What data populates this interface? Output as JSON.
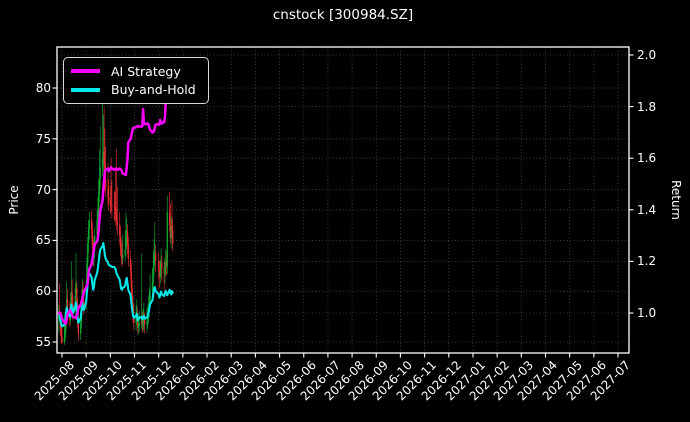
{
  "title": "cnstock [300984.SZ]",
  "axes": {
    "y_left": {
      "label": "Price",
      "ticks": [
        55,
        60,
        65,
        70,
        75,
        80
      ]
    },
    "y_right": {
      "label": "Return",
      "ticks": [
        "1.0",
        "1.2",
        "1.4",
        "1.6",
        "1.8",
        "2.0"
      ]
    },
    "x": {
      "tick_labels": [
        "2025-08",
        "2025-09",
        "2025-10",
        "2025-11",
        "2025-12",
        "2026-01",
        "2026-02",
        "2026-03",
        "2026-04",
        "2026-05",
        "2026-06",
        "2026-07",
        "2026-08",
        "2026-09",
        "2026-10",
        "2026-11",
        "2026-12",
        "2027-01",
        "2027-02",
        "2027-03",
        "2027-04",
        "2027-05",
        "2027-06",
        "2027-07"
      ]
    }
  },
  "legend": {
    "items": [
      {
        "label": "AI Strategy",
        "color": "#ff00ff"
      },
      {
        "label": "Buy-and-Hold",
        "color": "#00e8e8"
      }
    ]
  },
  "colors": {
    "background": "#000000",
    "grid": "#4c4c4c",
    "spine": "#ffffff",
    "text": "#ffffff",
    "candle_up": "#0ca832",
    "candle_down": "#e62e2e",
    "ai_strategy": "#ff00ff",
    "buy_and_hold": "#00e8e8"
  },
  "chart_data": [
    {
      "type": "candlestick",
      "title": "cnstock [300984.SZ]",
      "ylabel": "Price",
      "ylim": [
        53.9,
        84.0
      ],
      "x_range": [
        "2025-08",
        "2027-07"
      ],
      "grid": true,
      "dates": [
        "2025-07-28",
        "2025-07-29",
        "2025-07-30",
        "2025-07-31",
        "2025-08-01",
        "2025-08-04",
        "2025-08-05",
        "2025-08-06",
        "2025-08-07",
        "2025-08-08",
        "2025-08-11",
        "2025-08-12",
        "2025-08-13",
        "2025-08-14",
        "2025-08-15",
        "2025-08-18",
        "2025-08-19",
        "2025-08-20",
        "2025-08-21",
        "2025-08-22",
        "2025-08-25",
        "2025-08-26",
        "2025-08-27",
        "2025-08-28",
        "2025-08-29",
        "2025-09-01",
        "2025-09-02",
        "2025-09-03",
        "2025-09-04",
        "2025-09-05",
        "2025-09-08",
        "2025-09-09",
        "2025-09-10",
        "2025-09-11",
        "2025-09-12",
        "2025-09-15",
        "2025-09-16",
        "2025-09-17",
        "2025-09-18",
        "2025-09-19",
        "2025-09-22",
        "2025-09-23",
        "2025-09-24",
        "2025-09-25",
        "2025-09-26",
        "2025-09-29",
        "2025-09-30",
        "2025-10-01",
        "2025-10-02",
        "2025-10-03",
        "2025-10-06",
        "2025-10-07",
        "2025-10-08",
        "2025-10-09",
        "2025-10-10",
        "2025-10-13",
        "2025-10-14",
        "2025-10-15",
        "2025-10-16",
        "2025-10-17",
        "2025-10-20",
        "2025-10-21",
        "2025-10-22",
        "2025-10-23",
        "2025-10-24",
        "2025-10-27",
        "2025-10-28",
        "2025-10-29",
        "2025-10-30",
        "2025-10-31",
        "2025-11-03",
        "2025-11-04",
        "2025-11-05",
        "2025-11-06",
        "2025-11-07",
        "2025-11-10",
        "2025-11-11",
        "2025-11-12",
        "2025-11-13",
        "2025-11-14",
        "2025-11-17",
        "2025-11-18",
        "2025-11-19",
        "2025-11-20",
        "2025-11-21",
        "2025-11-24",
        "2025-11-25",
        "2025-11-26",
        "2025-11-27",
        "2025-11-28",
        "2025-12-01",
        "2025-12-02",
        "2025-12-03",
        "2025-12-04",
        "2025-12-05",
        "2025-12-08",
        "2025-12-09",
        "2025-12-10",
        "2025-12-11",
        "2025-12-12",
        "2025-12-15",
        "2025-12-16",
        "2025-12-17",
        "2025-12-18",
        "2025-12-19"
      ],
      "ohlc": [
        [
          57.2,
          58.6,
          55.9,
          58.0
        ],
        [
          58.0,
          60.8,
          56.9,
          57.3
        ],
        [
          57.3,
          58.0,
          55.6,
          56.2
        ],
        [
          56.2,
          57.2,
          54.9,
          55.5
        ],
        [
          55.5,
          56.4,
          54.8,
          55.0
        ],
        [
          55.0,
          56.6,
          54.7,
          55.4
        ],
        [
          55.4,
          57.9,
          55.0,
          56.2
        ],
        [
          56.2,
          58.4,
          55.7,
          57.8
        ],
        [
          57.8,
          60.9,
          57.2,
          59.2
        ],
        [
          59.2,
          60.2,
          57.6,
          58.3
        ],
        [
          58.3,
          59.0,
          56.5,
          57.2
        ],
        [
          57.2,
          59.9,
          56.8,
          58.6
        ],
        [
          58.6,
          62.9,
          58.0,
          59.9
        ],
        [
          59.9,
          61.2,
          58.2,
          58.8
        ],
        [
          58.8,
          59.6,
          57.1,
          58.0
        ],
        [
          58.0,
          60.8,
          57.5,
          59.6
        ],
        [
          59.6,
          63.8,
          59.0,
          60.3
        ],
        [
          60.3,
          61.0,
          58.2,
          58.7
        ],
        [
          58.7,
          59.3,
          56.4,
          56.9
        ],
        [
          56.9,
          57.8,
          55.1,
          55.8
        ],
        [
          55.8,
          57.6,
          55.2,
          56.9
        ],
        [
          56.9,
          59.5,
          56.3,
          58.7
        ],
        [
          58.7,
          61.2,
          58.1,
          60.2
        ],
        [
          60.2,
          61.0,
          58.4,
          59.0
        ],
        [
          59.0,
          59.8,
          57.7,
          58.7
        ],
        [
          58.7,
          61.1,
          58.2,
          60.5
        ],
        [
          60.5,
          63.4,
          59.8,
          62.8
        ],
        [
          62.8,
          65.3,
          62.0,
          64.7
        ],
        [
          64.7,
          67.0,
          63.8,
          66.2
        ],
        [
          66.2,
          67.8,
          65.1,
          67.0
        ],
        [
          67.0,
          67.9,
          65.2,
          66.0
        ],
        [
          66.0,
          66.8,
          63.8,
          64.5
        ],
        [
          64.5,
          65.4,
          62.5,
          63.2
        ],
        [
          63.2,
          65.0,
          62.4,
          64.0
        ],
        [
          64.0,
          66.3,
          63.3,
          65.5
        ],
        [
          65.5,
          68.0,
          64.8,
          67.0
        ],
        [
          67.0,
          69.2,
          66.1,
          68.1
        ],
        [
          68.1,
          71.0,
          67.3,
          69.5
        ],
        [
          69.5,
          73.9,
          68.8,
          71.0
        ],
        [
          71.0,
          76.2,
          70.1,
          72.2
        ],
        [
          72.2,
          78.8,
          71.3,
          73.0
        ],
        [
          73.0,
          77.4,
          71.8,
          73.7
        ],
        [
          73.7,
          78.1,
          71.5,
          72.5
        ],
        [
          72.5,
          76.0,
          69.9,
          71.0
        ],
        [
          71.0,
          74.2,
          69.3,
          70.2
        ],
        [
          70.2,
          72.6,
          68.4,
          69.3
        ],
        [
          69.3,
          71.0,
          67.9,
          68.8
        ],
        [
          68.8,
          70.4,
          67.6,
          68.6
        ],
        [
          68.6,
          73.1,
          67.8,
          68.5
        ],
        [
          68.5,
          70.9,
          67.2,
          68.4
        ],
        [
          68.4,
          69.8,
          66.9,
          68.3
        ],
        [
          68.3,
          69.9,
          67.0,
          68.1
        ],
        [
          68.1,
          72.2,
          66.5,
          67.6
        ],
        [
          67.6,
          74.0,
          66.0,
          66.8
        ],
        [
          66.8,
          70.3,
          65.5,
          66.5
        ],
        [
          66.5,
          67.8,
          64.6,
          65.5
        ],
        [
          65.5,
          66.4,
          63.5,
          64.3
        ],
        [
          64.3,
          65.2,
          62.6,
          63.4
        ],
        [
          63.4,
          64.8,
          62.4,
          63.2
        ],
        [
          63.2,
          65.6,
          62.7,
          63.6
        ],
        [
          63.6,
          66.0,
          63.0,
          64.1
        ],
        [
          64.1,
          67.7,
          63.4,
          65.3
        ],
        [
          65.3,
          67.2,
          64.4,
          65.9
        ],
        [
          65.9,
          66.6,
          63.7,
          64.6
        ],
        [
          64.6,
          65.3,
          62.4,
          63.2
        ],
        [
          63.2,
          64.0,
          61.2,
          62.0
        ],
        [
          62.0,
          62.8,
          59.6,
          60.3
        ],
        [
          60.3,
          61.1,
          58.0,
          58.7
        ],
        [
          58.7,
          59.5,
          56.9,
          57.6
        ],
        [
          57.6,
          58.8,
          56.2,
          56.9
        ],
        [
          56.9,
          58.6,
          56.1,
          57.4
        ],
        [
          57.4,
          59.2,
          56.7,
          57.8
        ],
        [
          57.8,
          58.4,
          55.8,
          56.4
        ],
        [
          56.4,
          57.7,
          55.7,
          56.6
        ],
        [
          56.6,
          58.1,
          56.0,
          56.9
        ],
        [
          56.9,
          63.7,
          56.3,
          57.2
        ],
        [
          57.2,
          58.0,
          55.9,
          56.6
        ],
        [
          56.6,
          58.3,
          56.0,
          56.9
        ],
        [
          56.9,
          58.9,
          56.2,
          57.3
        ],
        [
          57.3,
          57.9,
          55.8,
          56.7
        ],
        [
          56.7,
          58.4,
          55.9,
          57.0
        ],
        [
          57.0,
          58.7,
          56.3,
          57.5
        ],
        [
          57.5,
          59.6,
          56.8,
          58.2
        ],
        [
          58.2,
          60.4,
          57.4,
          59.0
        ],
        [
          59.0,
          61.7,
          58.3,
          60.0
        ],
        [
          60.0,
          62.3,
          59.2,
          60.9
        ],
        [
          60.9,
          64.0,
          60.1,
          62.2
        ],
        [
          62.2,
          65.1,
          61.4,
          63.4
        ],
        [
          63.4,
          66.8,
          62.6,
          63.8
        ],
        [
          63.8,
          64.6,
          61.9,
          63.0
        ],
        [
          63.0,
          63.8,
          61.2,
          62.2
        ],
        [
          62.2,
          63.0,
          60.3,
          61.5
        ],
        [
          61.5,
          63.1,
          60.7,
          62.0
        ],
        [
          62.0,
          64.2,
          61.3,
          62.8
        ],
        [
          62.8,
          63.5,
          60.9,
          62.2
        ],
        [
          62.2,
          62.9,
          60.1,
          61.8
        ],
        [
          61.8,
          63.3,
          60.8,
          62.4
        ],
        [
          62.4,
          64.1,
          61.5,
          63.0
        ],
        [
          63.0,
          63.9,
          61.6,
          62.4
        ],
        [
          62.4,
          69.4,
          61.7,
          67.8
        ],
        [
          67.8,
          69.7,
          65.9,
          66.5
        ],
        [
          66.5,
          68.6,
          64.7,
          65.2
        ],
        [
          65.2,
          67.3,
          64.2,
          66.4
        ],
        [
          66.4,
          68.9,
          65.3,
          66.0
        ],
        [
          66.0,
          67.1,
          63.9,
          64.6
        ]
      ]
    },
    {
      "type": "line",
      "ylabel": "Return",
      "ylim": [
        0.85,
        2.03
      ],
      "x_range": [
        "2025-08",
        "2027-07"
      ],
      "grid": true,
      "legend_position": "upper left",
      "dates_shared_with": "candlestick",
      "series": [
        {
          "name": "AI Strategy",
          "axis": "right",
          "values": [
            1.0,
            1.002,
            0.998,
            0.99,
            0.978,
            0.965,
            0.96,
            0.958,
            0.975,
            0.995,
            1.01,
            1.006,
            1.0,
            0.992,
            0.985,
            0.982,
            0.98,
            0.99,
            1.0,
            1.02,
            1.032,
            1.045,
            1.055,
            1.065,
            1.082,
            1.1,
            1.108,
            1.115,
            1.15,
            1.17,
            1.19,
            1.21,
            1.23,
            1.248,
            1.265,
            1.278,
            1.29,
            1.32,
            1.357,
            1.395,
            1.437,
            1.48,
            1.515,
            1.55,
            1.555,
            1.56,
            1.55,
            1.558,
            1.565,
            1.56,
            1.555,
            1.558,
            1.56,
            1.557,
            1.555,
            1.56,
            1.558,
            1.555,
            1.548,
            1.54,
            1.537,
            1.535,
            1.568,
            1.6,
            1.66,
            1.675,
            1.69,
            1.702,
            1.715,
            1.718,
            1.72,
            1.722,
            1.724,
            1.725,
            1.723,
            1.722,
            1.724,
            1.79,
            1.735,
            1.732,
            1.734,
            1.735,
            1.73,
            1.72,
            1.71,
            1.7,
            1.702,
            1.705,
            1.718,
            1.73,
            1.732,
            1.73,
            1.748,
            1.74,
            1.735,
            1.74,
            1.76,
            1.82,
            1.88,
            1.935,
            1.96,
            1.97,
            null,
            null,
            null
          ]
        },
        {
          "name": "Buy-and-Hold",
          "axis": "right",
          "values": [
            1.0,
            0.988,
            0.969,
            0.957,
            0.948,
            0.955,
            0.969,
            0.997,
            1.021,
            1.005,
            0.986,
            1.01,
            1.033,
            1.014,
            1.0,
            1.028,
            1.04,
            1.012,
            0.981,
            0.962,
            0.981,
            1.012,
            1.038,
            1.017,
            1.012,
            1.043,
            1.083,
            1.116,
            1.141,
            1.155,
            1.138,
            1.112,
            1.09,
            1.103,
            1.129,
            1.155,
            1.174,
            1.198,
            1.224,
            1.245,
            1.259,
            1.271,
            1.25,
            1.224,
            1.21,
            1.195,
            1.186,
            1.183,
            1.181,
            1.179,
            1.178,
            1.174,
            1.166,
            1.152,
            1.147,
            1.129,
            1.109,
            1.093,
            1.09,
            1.097,
            1.105,
            1.126,
            1.136,
            1.114,
            1.09,
            1.069,
            1.04,
            1.012,
            0.993,
            0.981,
            0.99,
            0.997,
            0.972,
            0.976,
            0.981,
            0.986,
            0.976,
            0.981,
            0.988,
            0.978,
            0.983,
            0.991,
            1.003,
            1.017,
            1.034,
            1.05,
            1.072,
            1.093,
            1.1,
            1.086,
            1.072,
            1.06,
            1.069,
            1.083,
            1.072,
            1.066,
            1.076,
            1.086,
            1.076,
            1.069,
            1.09,
            1.08,
            1.072,
            1.085,
            1.078
          ]
        }
      ]
    }
  ]
}
